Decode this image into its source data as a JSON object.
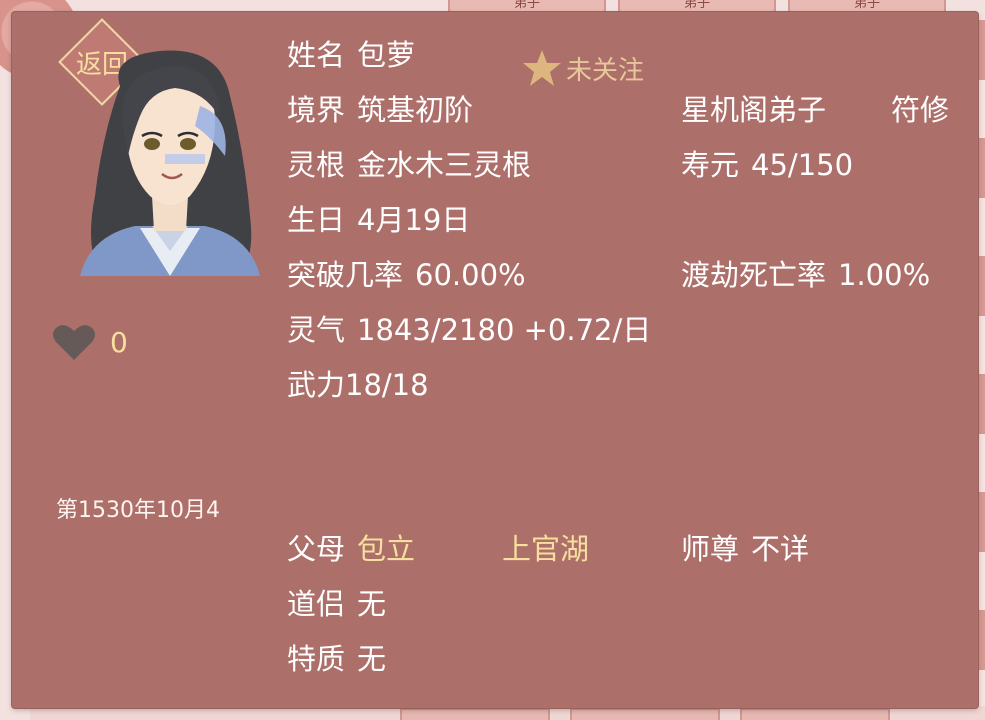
{
  "back_label": "返回",
  "follow": {
    "label": "未关注",
    "icon": "star-icon"
  },
  "likes": {
    "icon": "heart-icon",
    "count": "0"
  },
  "date": "第1530年10月4",
  "character": {
    "name_label": "姓名",
    "name": "包萝",
    "realm_label": "境界",
    "realm": "筑基初阶",
    "sect": "星机阁弟子",
    "profession": "符修",
    "root_label": "灵根",
    "root": "金水木三灵根",
    "lifespan_label": "寿元",
    "lifespan": "45/150",
    "birthday_label": "生日",
    "birthday": "4月19日",
    "breakthrough_label": "突破几率",
    "breakthrough": "60.00%",
    "tribulation_label": "渡劫死亡率",
    "tribulation": "1.00%",
    "qi_label": "灵气",
    "qi": "1843/2180 +0.72/日",
    "power": "武力18/18",
    "parents_label": "父母",
    "father": "包立",
    "mother": "上官湖",
    "master_label": "师尊",
    "master": "不详",
    "partner_label": "道侣",
    "partner": "无",
    "traits_label": "特质",
    "traits": "无"
  },
  "background": {
    "tabs": [
      "弟子",
      "弟子",
      "弟子"
    ]
  },
  "colors": {
    "panel": "#ad6f6a",
    "highlight": "#f7df9f",
    "text": "#ffffff"
  }
}
